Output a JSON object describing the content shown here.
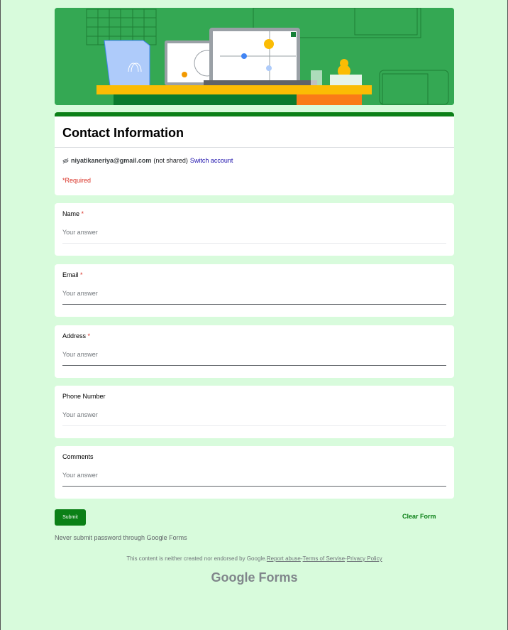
{
  "form": {
    "title": "Contact Information",
    "account_email": "niyatikaneriya@gmail.com",
    "not_shared": "(not shared)",
    "switch_account": "Switch account",
    "required_note": "*Required"
  },
  "questions": [
    {
      "label": "Name",
      "required": "*",
      "placeholder": "Your answer"
    },
    {
      "label": "Email",
      "required": "*",
      "placeholder": "Your answer"
    },
    {
      "label": "Address",
      "required": "*",
      "placeholder": "Your answer"
    },
    {
      "label": "Phone Number",
      "required": "",
      "placeholder": "Your answer"
    },
    {
      "label": "Comments",
      "required": "",
      "placeholder": "Your answer"
    }
  ],
  "actions": {
    "submit_label": "Submit",
    "clear_label": "Clear Form"
  },
  "notice": "Never submit password through Google Forms",
  "footer": {
    "disclaimer": "This content is neither created nor endorsed by Google.",
    "report_abuse": "Report abuse",
    "sep1": "-",
    "terms": "Terms of Servise",
    "sep2": "-",
    "privacy": "Privacy Policy",
    "brand": "Google Forms"
  },
  "colors": {
    "accent": "#0b8017",
    "page_bg": "#d8fbdc",
    "required": "#d93025"
  },
  "icons": {
    "account": "eye-slash-icon"
  }
}
